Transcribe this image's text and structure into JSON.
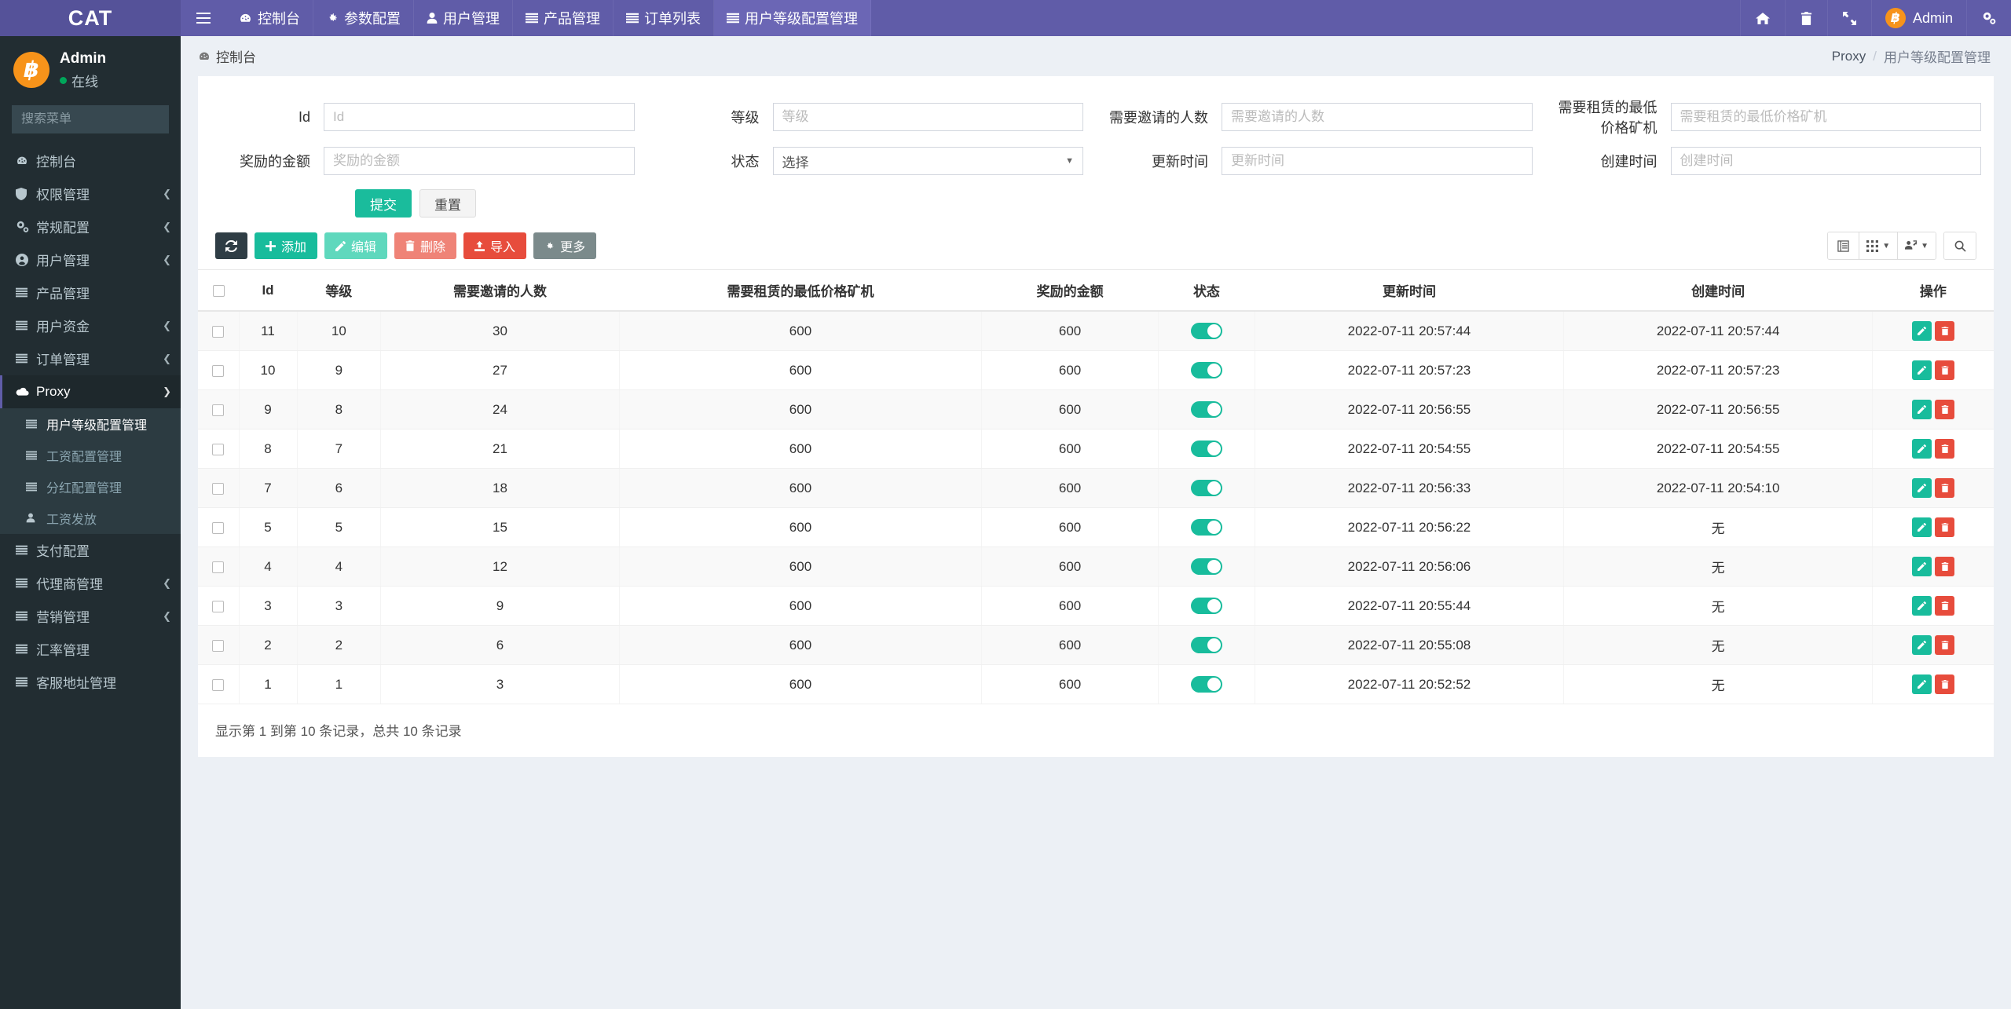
{
  "brand": {
    "title": "CAT"
  },
  "topnav": {
    "hamburger_label": "☰",
    "items": [
      {
        "label": "控制台",
        "icon": "dashboard-icon",
        "active": false
      },
      {
        "label": "参数配置",
        "icon": "gear-icon",
        "active": false
      },
      {
        "label": "用户管理",
        "icon": "user-icon",
        "active": false
      },
      {
        "label": "产品管理",
        "icon": "list-icon",
        "active": false
      },
      {
        "label": "订单列表",
        "icon": "list-icon",
        "active": false
      },
      {
        "label": "用户等级配置管理",
        "icon": "list-icon",
        "active": true
      }
    ],
    "right_icons": [
      "home-icon",
      "trash-icon",
      "fullscreen-icon"
    ],
    "user_label": "Admin",
    "settings_icon": "gears-icon"
  },
  "sidebar": {
    "user": {
      "name": "Admin",
      "status": "在线"
    },
    "search_placeholder": "搜索菜单",
    "items": [
      {
        "label": "控制台",
        "icon": "dashboard-icon",
        "arrow": false
      },
      {
        "label": "权限管理",
        "icon": "shield-icon",
        "arrow": true
      },
      {
        "label": "常规配置",
        "icon": "gears-icon",
        "arrow": true
      },
      {
        "label": "用户管理",
        "icon": "user-circle-icon",
        "arrow": true
      },
      {
        "label": "产品管理",
        "icon": "list-icon",
        "arrow": false
      },
      {
        "label": "用户资金",
        "icon": "list-icon",
        "arrow": true
      },
      {
        "label": "订单管理",
        "icon": "list-icon",
        "arrow": true
      },
      {
        "label": "Proxy",
        "icon": "cloud-icon",
        "arrow": true,
        "open": true
      },
      {
        "label": "支付配置",
        "icon": "list-icon",
        "arrow": false
      },
      {
        "label": "代理商管理",
        "icon": "list-icon",
        "arrow": true
      },
      {
        "label": "营销管理",
        "icon": "list-icon",
        "arrow": true
      },
      {
        "label": "汇率管理",
        "icon": "list-icon",
        "arrow": false
      },
      {
        "label": "客服地址管理",
        "icon": "list-icon",
        "arrow": false
      }
    ],
    "proxy_submenu": [
      {
        "label": "用户等级配置管理",
        "icon": "list-icon",
        "active": true
      },
      {
        "label": "工资配置管理",
        "icon": "list-icon",
        "active": false
      },
      {
        "label": "分红配置管理",
        "icon": "list-icon",
        "active": false
      },
      {
        "label": "工资发放",
        "icon": "user-icon",
        "active": false
      }
    ]
  },
  "content_header": {
    "title": "控制台",
    "breadcrumb": {
      "root": "Proxy",
      "separator": "/",
      "current": "用户等级配置管理"
    }
  },
  "search_form": {
    "fields": [
      {
        "label": "Id",
        "placeholder": "Id",
        "value": "",
        "type": "text"
      },
      {
        "label": "等级",
        "placeholder": "等级",
        "value": "",
        "type": "text"
      },
      {
        "label": "需要邀请的人数",
        "placeholder": "需要邀请的人数",
        "value": "",
        "type": "text"
      },
      {
        "label": "需要租赁的最低价格矿机",
        "placeholder": "需要租赁的最低价格矿机",
        "value": "",
        "type": "text"
      },
      {
        "label": "奖励的金额",
        "placeholder": "奖励的金额",
        "value": "",
        "type": "text"
      },
      {
        "label": "状态",
        "placeholder": "选择",
        "value": "选择",
        "type": "select"
      },
      {
        "label": "更新时间",
        "placeholder": "更新时间",
        "value": "",
        "type": "text"
      },
      {
        "label": "创建时间",
        "placeholder": "创建时间",
        "value": "",
        "type": "text"
      }
    ],
    "submit_label": "提交",
    "reset_label": "重置"
  },
  "toolbar": {
    "refresh_icon": "refresh-icon",
    "add_label": "添加",
    "edit_label": "编辑",
    "delete_label": "删除",
    "import_label": "导入",
    "more_label": "更多",
    "right_icons": [
      "table-view-icon",
      "columns-icon",
      "export-icon",
      "search-icon"
    ]
  },
  "table": {
    "columns": [
      "Id",
      "等级",
      "需要邀请的人数",
      "需要租赁的最低价格矿机",
      "奖励的金额",
      "状态",
      "更新时间",
      "创建时间",
      "操作"
    ],
    "rows": [
      {
        "id": "11",
        "level": "10",
        "invites": "30",
        "min_price": "600",
        "reward": "600",
        "status": true,
        "updated": "2022-07-11 20:57:44",
        "created": "2022-07-11 20:57:44"
      },
      {
        "id": "10",
        "level": "9",
        "invites": "27",
        "min_price": "600",
        "reward": "600",
        "status": true,
        "updated": "2022-07-11 20:57:23",
        "created": "2022-07-11 20:57:23"
      },
      {
        "id": "9",
        "level": "8",
        "invites": "24",
        "min_price": "600",
        "reward": "600",
        "status": true,
        "updated": "2022-07-11 20:56:55",
        "created": "2022-07-11 20:56:55"
      },
      {
        "id": "8",
        "level": "7",
        "invites": "21",
        "min_price": "600",
        "reward": "600",
        "status": true,
        "updated": "2022-07-11 20:54:55",
        "created": "2022-07-11 20:54:55"
      },
      {
        "id": "7",
        "level": "6",
        "invites": "18",
        "min_price": "600",
        "reward": "600",
        "status": true,
        "updated": "2022-07-11 20:56:33",
        "created": "2022-07-11 20:54:10"
      },
      {
        "id": "5",
        "level": "5",
        "invites": "15",
        "min_price": "600",
        "reward": "600",
        "status": true,
        "updated": "2022-07-11 20:56:22",
        "created": "无"
      },
      {
        "id": "4",
        "level": "4",
        "invites": "12",
        "min_price": "600",
        "reward": "600",
        "status": true,
        "updated": "2022-07-11 20:56:06",
        "created": "无"
      },
      {
        "id": "3",
        "level": "3",
        "invites": "9",
        "min_price": "600",
        "reward": "600",
        "status": true,
        "updated": "2022-07-11 20:55:44",
        "created": "无"
      },
      {
        "id": "2",
        "level": "2",
        "invites": "6",
        "min_price": "600",
        "reward": "600",
        "status": true,
        "updated": "2022-07-11 20:55:08",
        "created": "无"
      },
      {
        "id": "1",
        "level": "1",
        "invites": "3",
        "min_price": "600",
        "reward": "600",
        "status": true,
        "updated": "2022-07-11 20:52:52",
        "created": "无"
      }
    ],
    "footer": "显示第 1 到第 10 条记录，总共 10 条记录"
  },
  "colors": {
    "accent": "#605ca8",
    "sidebar": "#222d32",
    "success": "#18bc9c",
    "danger": "#e74c3c",
    "bitcoin": "#f7931a"
  }
}
